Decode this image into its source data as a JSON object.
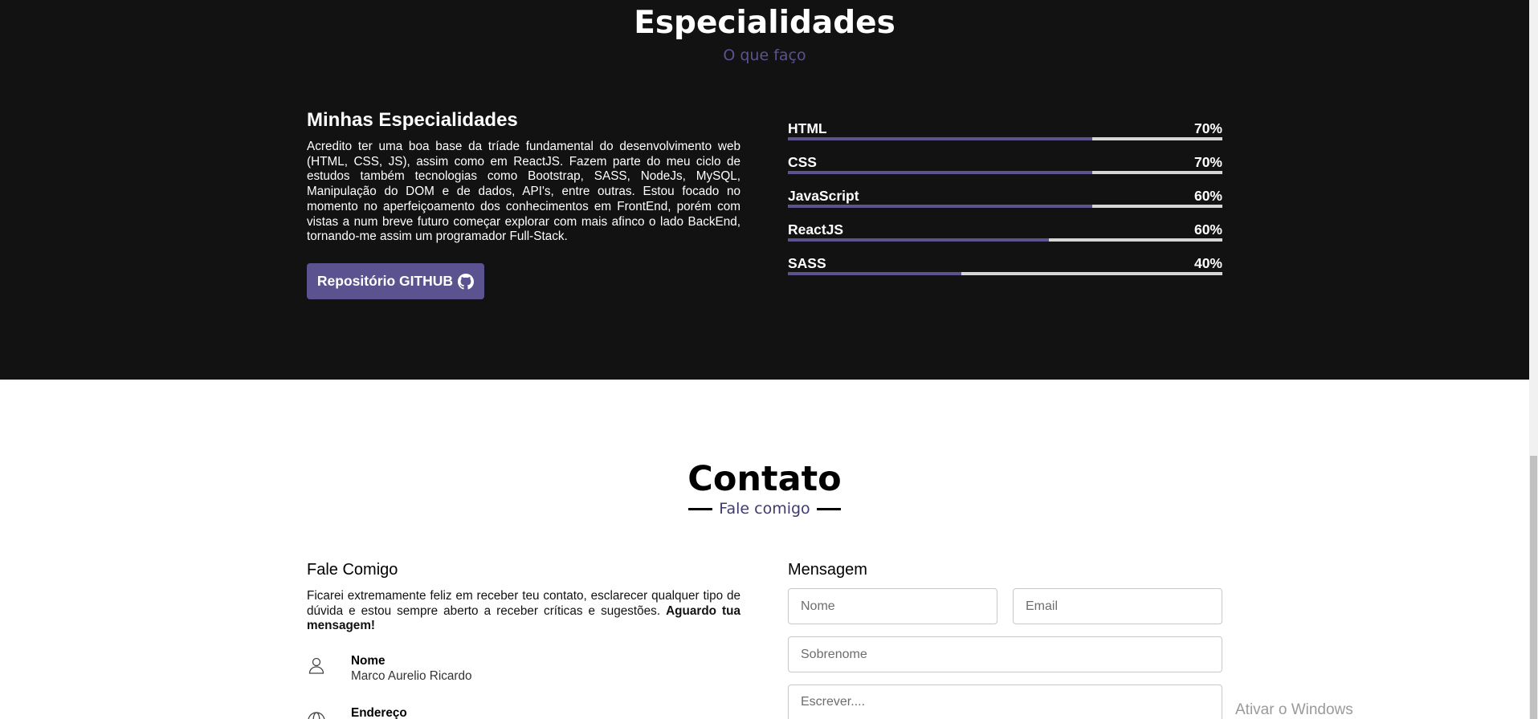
{
  "especialidades": {
    "title": "Especialidades",
    "subtitle": "O que faço",
    "heading": "Minhas Especialidades",
    "text": "Acredito ter uma boa base da tríade fundamental do desenvolvimento web (HTML, CSS, JS), assim como em ReactJS. Fazem parte do meu ciclo de estudos também tecnologias como Bootstrap, SASS, NodeJs, MySQL, Manipulação do DOM e de dados, API's, entre outras. Estou focado no momento no aperfeiçoamento dos conhecimentos em FrontEnd, porém com vistas a num breve futuro começar explorar com mais afinco o lado BackEnd, tornando-me assim um programador Full-Stack.",
    "button_label": "Repositório GITHUB",
    "button_icon": "github-icon",
    "skills": [
      {
        "name": "HTML",
        "label": "70%",
        "value": 70
      },
      {
        "name": "CSS",
        "label": "70%",
        "value": 70
      },
      {
        "name": "JavaScript",
        "label": "60%",
        "value": 70
      },
      {
        "name": "ReactJS",
        "label": "60%",
        "value": 60
      },
      {
        "name": "SASS",
        "label": "40%",
        "value": 40
      }
    ],
    "accent_color": "#5b5390",
    "background_color": "#121212"
  },
  "contato": {
    "title": "Contato",
    "subtitle": "Fale comigo",
    "heading": "Fale Comigo",
    "text": "Ficarei extremamente feliz em receber teu contato, esclarecer qualquer tipo de dúvida e estou sempre aberto a receber críticas e sugestões.",
    "text_bold": "Aguardo tua mensagem!",
    "info": [
      {
        "label": "Nome",
        "value": "Marco Aurelio Ricardo",
        "icon": "user-icon"
      },
      {
        "label": "Endereço",
        "value": "",
        "icon": "globe-icon"
      }
    ],
    "form": {
      "heading": "Mensagem",
      "nome_placeholder": "Nome",
      "email_placeholder": "Email",
      "sobrenome_placeholder": "Sobrenome",
      "mensagem_placeholder": "Escrever...."
    }
  },
  "watermark": "Ativar o Windows"
}
